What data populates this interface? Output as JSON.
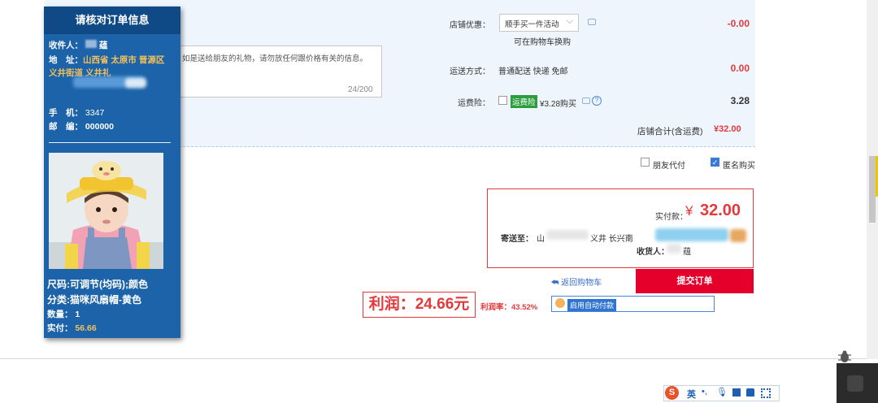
{
  "panel": {
    "title": "请核对订单信息",
    "receiver_label": "收件人：",
    "receiver_name": "蕴",
    "address_label": "地　址：",
    "address_line1": "山西省 太原市 晋源区",
    "address_line2": "义井街道 义井礼",
    "phone_label": "手　机：",
    "phone_value": "3347",
    "postcode_label": "邮　编：",
    "postcode_value": "000000",
    "spec_line1": "尺码:可调节(均码);颜色",
    "spec_line2": "分类:猫咪风扇帽-黄色",
    "qty_label": "数量：",
    "qty_value": "1",
    "paid_label": "实付：",
    "paid_value": "56.66"
  },
  "order": {
    "message_text": "如是送给朋友的礼物，请勿放任何跟价格有关的信息。",
    "message_count": "24/200",
    "shop_discount_label": "店铺优惠：",
    "shop_discount_option": "顺手买一件活动",
    "shop_discount_hint": "可在购物车换购",
    "shop_discount_amount": "-0.00",
    "shipping_label": "运送方式：",
    "shipping_value": "普通配送 快递 免邮",
    "shipping_amount": "0.00",
    "insurance_label": "运费险：",
    "insurance_tag": "运费险",
    "insurance_price": "¥3.28购买",
    "insurance_amount": "3.28",
    "shop_total_label": "店铺合计(含运费)",
    "shop_total_value": "¥32.00",
    "friend_pay_label": "朋友代付",
    "anonymous_label": "匿名购买"
  },
  "payment": {
    "paid_label": "实付款：",
    "currency": "¥",
    "paid_amount": "32.00",
    "ship_to_label": "寄送至：",
    "ship_to_partial": "山",
    "ship_to_partial2": "义井 长兴南",
    "receiver_label": "收货人：",
    "receiver_partial": "蕴",
    "back_to_cart": "返回购物车",
    "submit": "提交订单"
  },
  "profit": {
    "profit_text": "利润：24.66元",
    "profit_rate": "利润率：43.52%",
    "auto_pay": "启用自动付款"
  },
  "ime": {
    "lang": "英"
  },
  "colors": {
    "accent_red": "#e4393c",
    "panel_blue": "#1c63a9",
    "panel_header": "#0f4a87",
    "link_blue": "#3a6fc8"
  }
}
